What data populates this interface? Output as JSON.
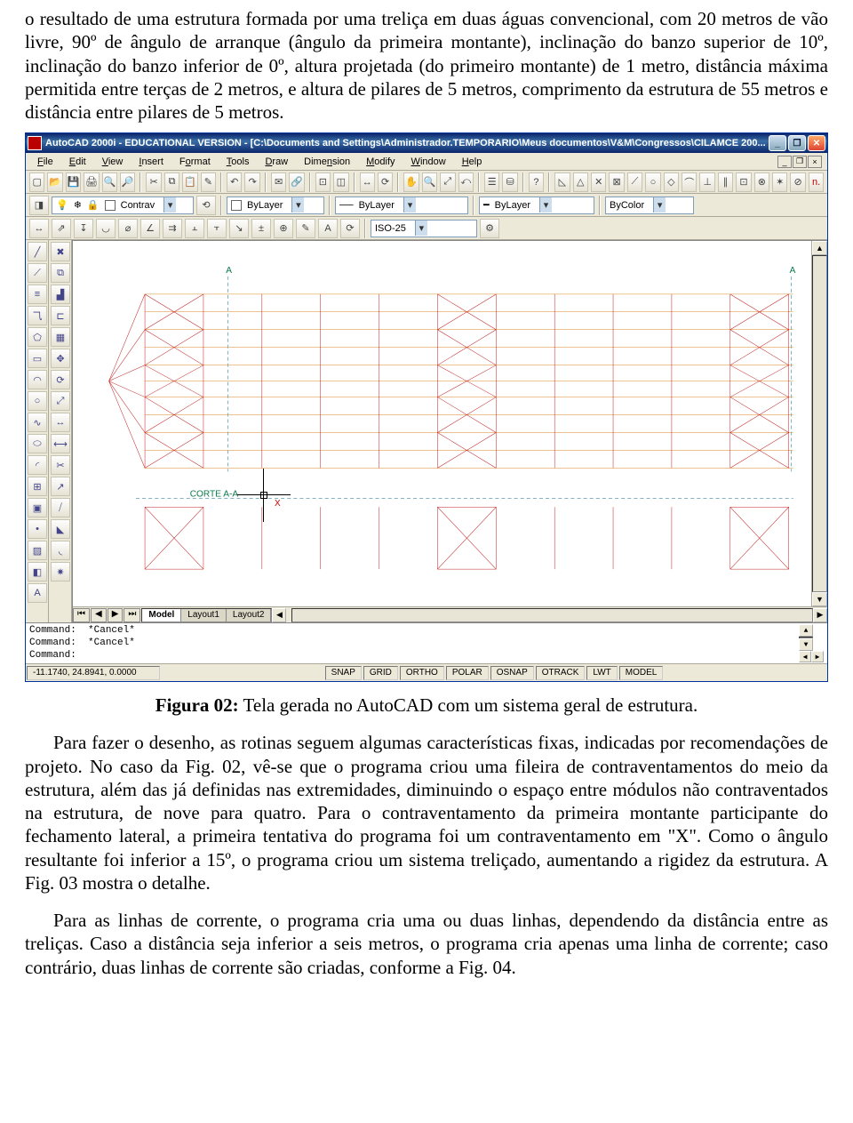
{
  "para1": "o resultado de uma estrutura formada por uma treliça em duas águas convencional, com 20 metros de vão livre, 90º de ângulo de arranque (ângulo da primeira montante), inclinação do banzo superior de 10º, inclinação do banzo inferior de 0º, altura projetada (do primeiro montante) de 1 metro, distância máxima permitida entre terças de 2 metros, e altura de pilares de 5 metros, comprimento da estrutura de 55 metros e distância entre pilares de 5 metros.",
  "caption_bold": "Figura 02:",
  "caption_rest": " Tela gerada no AutoCAD com um sistema geral de estrutura.",
  "para2": "Para fazer o desenho, as rotinas seguem algumas características fixas, indicadas por recomendações de projeto. No caso da Fig. 02, vê-se que o programa criou uma fileira de contraventamentos do meio da estrutura, além das já definidas nas extremidades, diminuindo o espaço entre módulos não contraventados na estrutura, de nove para quatro. Para o contraventamento da primeira montante participante do fechamento lateral, a primeira tentativa do programa foi um contraventamento em \"X\". Como o ângulo resultante foi inferior a 15º, o programa criou um sistema treliçado, aumentando a rigidez da estrutura. A Fig. 03 mostra o detalhe.",
  "para3": "Para as linhas de corrente, o programa cria uma ou duas linhas, dependendo da distância entre as treliças. Caso a distância seja inferior a seis metros, o programa cria apenas uma linha de corrente; caso contrário, duas linhas de corrente são criadas, conforme a Fig. 04.",
  "acad": {
    "title": "AutoCAD 2000i - EDUCATIONAL VERSION - [C:\\Documents and Settings\\Administrador.TEMPORARIO\\Meus documentos\\V&M\\Congressos\\CILAMCE 200...",
    "menus": [
      "File",
      "Edit",
      "View",
      "Insert",
      "Format",
      "Tools",
      "Draw",
      "Dimension",
      "Modify",
      "Window",
      "Help"
    ],
    "layer": "Contrav",
    "bylayer1": "ByLayer",
    "bylayer2": "ByLayer",
    "bylayer3": "ByLayer",
    "bycolor": "ByColor",
    "dimstyle": "ISO-25",
    "tabs": {
      "model": "Model",
      "l1": "Layout1",
      "l2": "Layout2"
    },
    "cmd1": "Command:  *Cancel*",
    "cmd2": "Command:  *Cancel*",
    "cmd3": "Command:",
    "coords": "-11.1740, 24.8941, 0.0000",
    "status": [
      "SNAP",
      "GRID",
      "ORTHO",
      "POLAR",
      "OSNAP",
      "OTRACK",
      "LWT",
      "MODEL"
    ],
    "corte": "CORTE A-A",
    "secA1": "A",
    "secA2": "A",
    "cursor_x": "X"
  }
}
